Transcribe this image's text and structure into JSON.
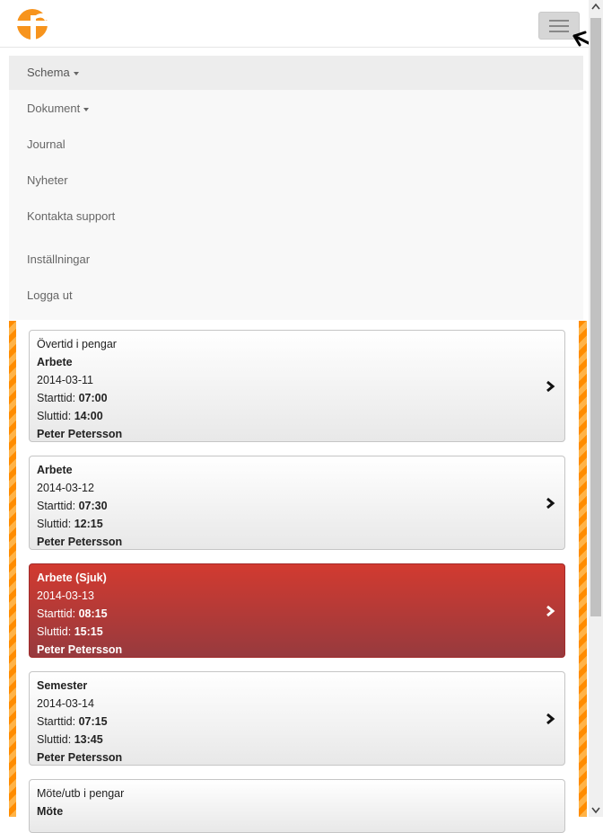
{
  "nav": {
    "items": [
      {
        "label": "Schema",
        "caret": true,
        "active": true
      },
      {
        "label": "Dokument",
        "caret": true,
        "active": false
      },
      {
        "label": "Journal",
        "caret": false,
        "active": false
      },
      {
        "label": "Nyheter",
        "caret": false,
        "active": false
      },
      {
        "label": "Kontakta support",
        "caret": false,
        "active": false
      },
      {
        "label": "Inställningar",
        "caret": false,
        "active": false
      },
      {
        "label": "Logga ut",
        "caret": false,
        "active": false
      }
    ]
  },
  "cards": [
    {
      "type_label": "Övertid i pengar",
      "title": "Arbete",
      "date": "2014-03-11",
      "start_label": "Starttid:",
      "start": "07:00",
      "end_label": "Sluttid:",
      "end": "14:00",
      "person": "Peter Petersson",
      "sick": false
    },
    {
      "type_label": "",
      "title": "Arbete",
      "date": "2014-03-12",
      "start_label": "Starttid:",
      "start": "07:30",
      "end_label": "Sluttid:",
      "end": "12:15",
      "person": "Peter Petersson",
      "sick": false
    },
    {
      "type_label": "",
      "title": "Arbete (Sjuk)",
      "date": "2014-03-13",
      "start_label": "Starttid:",
      "start": "08:15",
      "end_label": "Sluttid:",
      "end": "15:15",
      "person": "Peter Petersson",
      "sick": true
    },
    {
      "type_label": "",
      "title": "Semester",
      "date": "2014-03-14",
      "start_label": "Starttid:",
      "start": "07:15",
      "end_label": "Sluttid:",
      "end": "13:45",
      "person": "Peter Petersson",
      "sick": false
    },
    {
      "type_label": "Möte/utb i pengar",
      "title": "Möte",
      "date": "",
      "start_label": "",
      "start": "",
      "end_label": "",
      "end": "",
      "person": "",
      "sick": false
    }
  ],
  "colors": {
    "brand_orange": "#ff8c00",
    "sick_red": "#c8352e"
  },
  "icons": {
    "logo": "company-logo",
    "menu": "hamburger-menu-icon",
    "chevron": "chevron-right-icon"
  }
}
